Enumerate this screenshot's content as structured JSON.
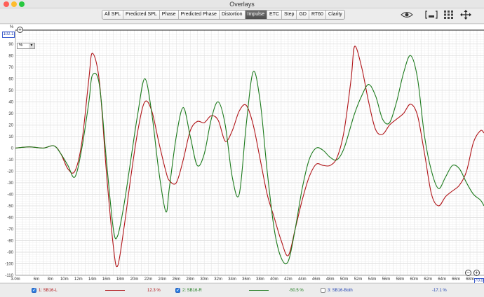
{
  "window": {
    "title": "Overlays"
  },
  "tabs": [
    {
      "label": "All SPL",
      "active": false
    },
    {
      "label": "Predicted SPL",
      "active": false
    },
    {
      "label": "Phase",
      "active": false
    },
    {
      "label": "Predicted Phase",
      "active": false
    },
    {
      "label": "Distortion",
      "active": false
    },
    {
      "label": "Impulse",
      "active": true
    },
    {
      "label": "ETC",
      "active": false
    },
    {
      "label": "Step",
      "active": false
    },
    {
      "label": "GD",
      "active": false
    },
    {
      "label": "RT60",
      "active": false
    },
    {
      "label": "Clarity",
      "active": false
    }
  ],
  "toolbar_icons": [
    "eye-icon",
    "bracket-icon",
    "grid-icon",
    "move-arrows-icon"
  ],
  "plot": {
    "y_unit": "%",
    "y_readout": "102.1",
    "mode_select": "%",
    "range_end": "70.0",
    "zoom_in": "+",
    "zoom_out": "−"
  },
  "chart_data": {
    "type": "line",
    "xlabel": "",
    "ylabel": "%",
    "x_ticks": [
      "3.0m",
      "6m",
      "8m",
      "10m",
      "12m",
      "14m",
      "16m",
      "18m",
      "20m",
      "22m",
      "24m",
      "26m",
      "28m",
      "30m",
      "32m",
      "34m",
      "36m",
      "38m",
      "40m",
      "42m",
      "44m",
      "46m",
      "48m",
      "50m",
      "52m",
      "54m",
      "56m",
      "58m",
      "60m",
      "62m",
      "64m",
      "66m",
      "68m"
    ],
    "y_ticks": [
      "90",
      "80",
      "70",
      "60",
      "50",
      "40",
      "30",
      "20",
      "10",
      "0",
      "-10",
      "-20",
      "-30",
      "-40",
      "-50",
      "-60",
      "-70",
      "-80",
      "-90",
      "-100",
      "-110"
    ],
    "xlim": [
      3.0,
      70.0
    ],
    "ylim": [
      -110,
      102
    ],
    "grid": true,
    "series": [
      {
        "name": "1: SB16-L",
        "color": "#b01418",
        "x": [
          3.0,
          5.0,
          7.0,
          8.5,
          9.5,
          10.5,
          11.5,
          12.5,
          13.5,
          14.0,
          15.0,
          16.0,
          17.0,
          17.6,
          18.5,
          19.5,
          20.5,
          21.5,
          22.5,
          23.5,
          24.5,
          25.0,
          26.0,
          27.0,
          28.0,
          29.0,
          30.0,
          31.0,
          32.0,
          33.0,
          34.0,
          35.0,
          36.0,
          37.0,
          38.0,
          39.0,
          40.0,
          41.0,
          42.0,
          43.0,
          44.0,
          45.0,
          46.0,
          47.0,
          48.0,
          49.0,
          50.0,
          51.0,
          51.5,
          52.5,
          53.5,
          54.5,
          55.5,
          56.5,
          57.5,
          58.5,
          59.5,
          60.5,
          61.5,
          62.5,
          63.5,
          64.5,
          65.5,
          66.5,
          67.5,
          68.5,
          69.5,
          70.0
        ],
        "y": [
          0,
          1,
          0,
          2,
          -5,
          -18,
          -20,
          5,
          60,
          82,
          58,
          -20,
          -85,
          -102,
          -70,
          -25,
          15,
          40,
          32,
          5,
          -20,
          -28,
          -30,
          -10,
          15,
          23,
          22,
          28,
          24,
          6,
          15,
          32,
          37,
          20,
          -10,
          -40,
          -60,
          -80,
          -93,
          -70,
          -45,
          -25,
          -14,
          -15,
          -15,
          -8,
          15,
          60,
          88,
          70,
          40,
          16,
          12,
          20,
          25,
          30,
          38,
          28,
          -5,
          -40,
          -50,
          -42,
          -37,
          -32,
          -20,
          5,
          15,
          13
        ]
      },
      {
        "name": "2: SB16-R",
        "color": "#1c7a1c",
        "x": [
          3.0,
          5.0,
          7.0,
          8.5,
          9.5,
          10.5,
          11.5,
          12.5,
          13.5,
          14.0,
          15.0,
          16.0,
          17.0,
          17.6,
          18.5,
          19.5,
          20.5,
          21.5,
          22.5,
          23.5,
          24.5,
          25.0,
          26.0,
          27.0,
          28.0,
          29.0,
          30.0,
          31.0,
          32.0,
          33.0,
          34.0,
          35.0,
          36.0,
          37.0,
          38.0,
          39.0,
          40.0,
          41.0,
          42.0,
          43.0,
          44.0,
          45.0,
          46.0,
          47.0,
          48.0,
          49.0,
          50.0,
          51.0,
          51.5,
          52.5,
          53.5,
          54.5,
          55.5,
          56.5,
          57.5,
          58.5,
          59.5,
          60.5,
          61.5,
          62.5,
          63.5,
          64.5,
          65.5,
          66.5,
          67.5,
          68.5,
          69.5,
          70.0
        ],
        "y": [
          0,
          1,
          0,
          2,
          -5,
          -15,
          -25,
          0,
          40,
          63,
          55,
          -10,
          -70,
          -76,
          -50,
          -10,
          30,
          60,
          30,
          -20,
          -55,
          -35,
          10,
          35,
          10,
          -15,
          -5,
          25,
          40,
          20,
          -25,
          -40,
          20,
          66,
          40,
          -20,
          -70,
          -95,
          -98,
          -70,
          -35,
          -10,
          0,
          -2,
          -8,
          -10,
          0,
          20,
          30,
          45,
          55,
          45,
          25,
          22,
          40,
          65,
          80,
          60,
          10,
          -20,
          -35,
          -25,
          -15,
          -18,
          -30,
          -40,
          -45,
          -50
        ]
      },
      {
        "name": "3: SB16-Both",
        "color": "#000000",
        "x": [],
        "y": []
      }
    ]
  },
  "legend": [
    {
      "index": "1: SB16-L",
      "value": "12.3 %",
      "checked": true,
      "color": "#b01418"
    },
    {
      "index": "2: SB16-R",
      "value": "-50.5 %",
      "checked": true,
      "color": "#1c7a1c"
    },
    {
      "index": "3: SB16-Both",
      "value": "-17.1 %",
      "checked": false,
      "color": "#1f3fb0"
    }
  ]
}
